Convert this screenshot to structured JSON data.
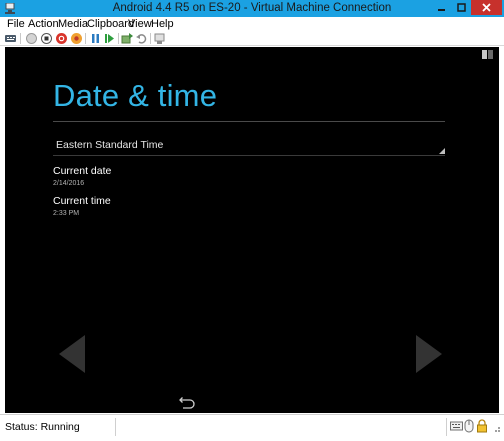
{
  "window": {
    "title": "Android 4.4 R5 on ES-20 - Virtual Machine Connection",
    "titlebar_color": "#1ba1e2",
    "close_color": "#c7312c"
  },
  "menu": {
    "items": [
      "File",
      "Action",
      "Media",
      "Clipboard",
      "View",
      "Help"
    ]
  },
  "toolbar": {
    "buttons": [
      "ctrl-alt-del-icon",
      "start-icon",
      "turn-off-icon",
      "shutdown-icon",
      "save-icon",
      "pause-icon",
      "reset-icon",
      "checkpoint-icon",
      "revert-icon",
      "enhanced-session-icon"
    ]
  },
  "android": {
    "page_title": "Date & time",
    "accent_color": "#33b5e5",
    "timezone": "Eastern Standard Time",
    "current_date_label": "Current date",
    "current_date_value": "2/14/2016",
    "current_time_label": "Current time",
    "current_time_value": "2:33 PM"
  },
  "statusbar": {
    "status": "Status: Running"
  }
}
